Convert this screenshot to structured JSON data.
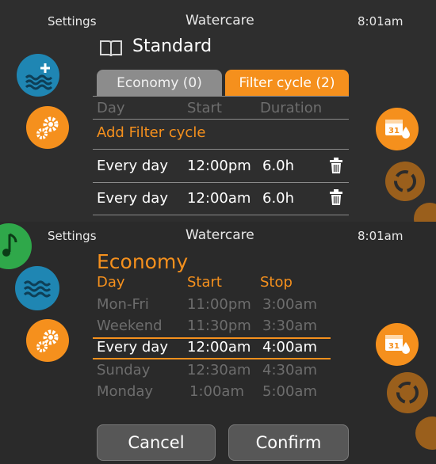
{
  "top": {
    "header": {
      "left": "Settings",
      "title": "Watercare",
      "time": "8:01am"
    },
    "mode_title": "Standard",
    "tabs": [
      {
        "label": "Economy (0)",
        "active": false
      },
      {
        "label": "Filter cycle (2)",
        "active": true
      }
    ],
    "columns": {
      "day": "Day",
      "start": "Start",
      "duration": "Duration"
    },
    "add_label": "Add Filter cycle",
    "rows": [
      {
        "day": "Every day",
        "start": "12:00pm",
        "duration": "6.0h"
      },
      {
        "day": "Every day",
        "start": "12:00am",
        "duration": "6.0h"
      }
    ]
  },
  "bottom": {
    "header": {
      "left": "Settings",
      "title": "Watercare",
      "time": "8:01am"
    },
    "mode_title": "Economy",
    "columns": {
      "day": "Day",
      "start": "Start",
      "stop": "Stop"
    },
    "rows": [
      {
        "day": "Mon-Fri",
        "start": "11:00pm",
        "stop": "3:00am",
        "selected": false
      },
      {
        "day": "Weekend",
        "start": "11:30pm",
        "stop": "3:30am",
        "selected": false
      },
      {
        "day": "Every day",
        "start": "12:00am",
        "stop": "4:00am",
        "selected": true
      },
      {
        "day": "Sunday",
        "start": "12:30am",
        "stop": "4:30am",
        "selected": false
      },
      {
        "day": "Monday",
        "start": "1:00am",
        "stop": "5:00am",
        "selected": false
      }
    ],
    "buttons": {
      "cancel": "Cancel",
      "confirm": "Confirm"
    }
  },
  "icons": {
    "calendar_day": "31",
    "names": [
      "water-add-icon",
      "gear-icon",
      "calendar-water-icon",
      "sync-icon",
      "music-icon",
      "waves-icon",
      "trash-icon",
      "book-icon"
    ]
  },
  "colors": {
    "accent": "#f5901d",
    "blue": "#1f86b3",
    "muted_text": "#6d6d6d",
    "background": "#2b2b2b"
  }
}
